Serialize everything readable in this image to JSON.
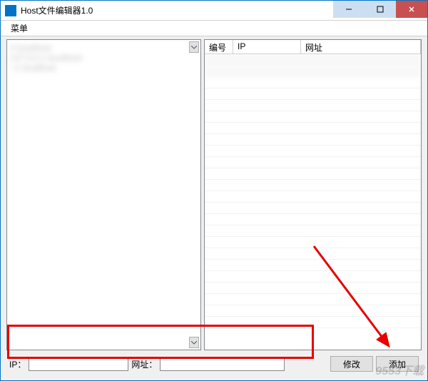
{
  "window": {
    "title": "Host文件编辑器1.0"
  },
  "menubar": {
    "menu_label": "菜单"
  },
  "table": {
    "headers": {
      "num": "编号",
      "ip": "IP",
      "url": "网址"
    }
  },
  "form": {
    "ip_label": "IP：",
    "url_label": "网址：",
    "ip_value": "",
    "url_value": ""
  },
  "buttons": {
    "modify": "修改",
    "add": "添加"
  },
  "watermark": "9553下载"
}
